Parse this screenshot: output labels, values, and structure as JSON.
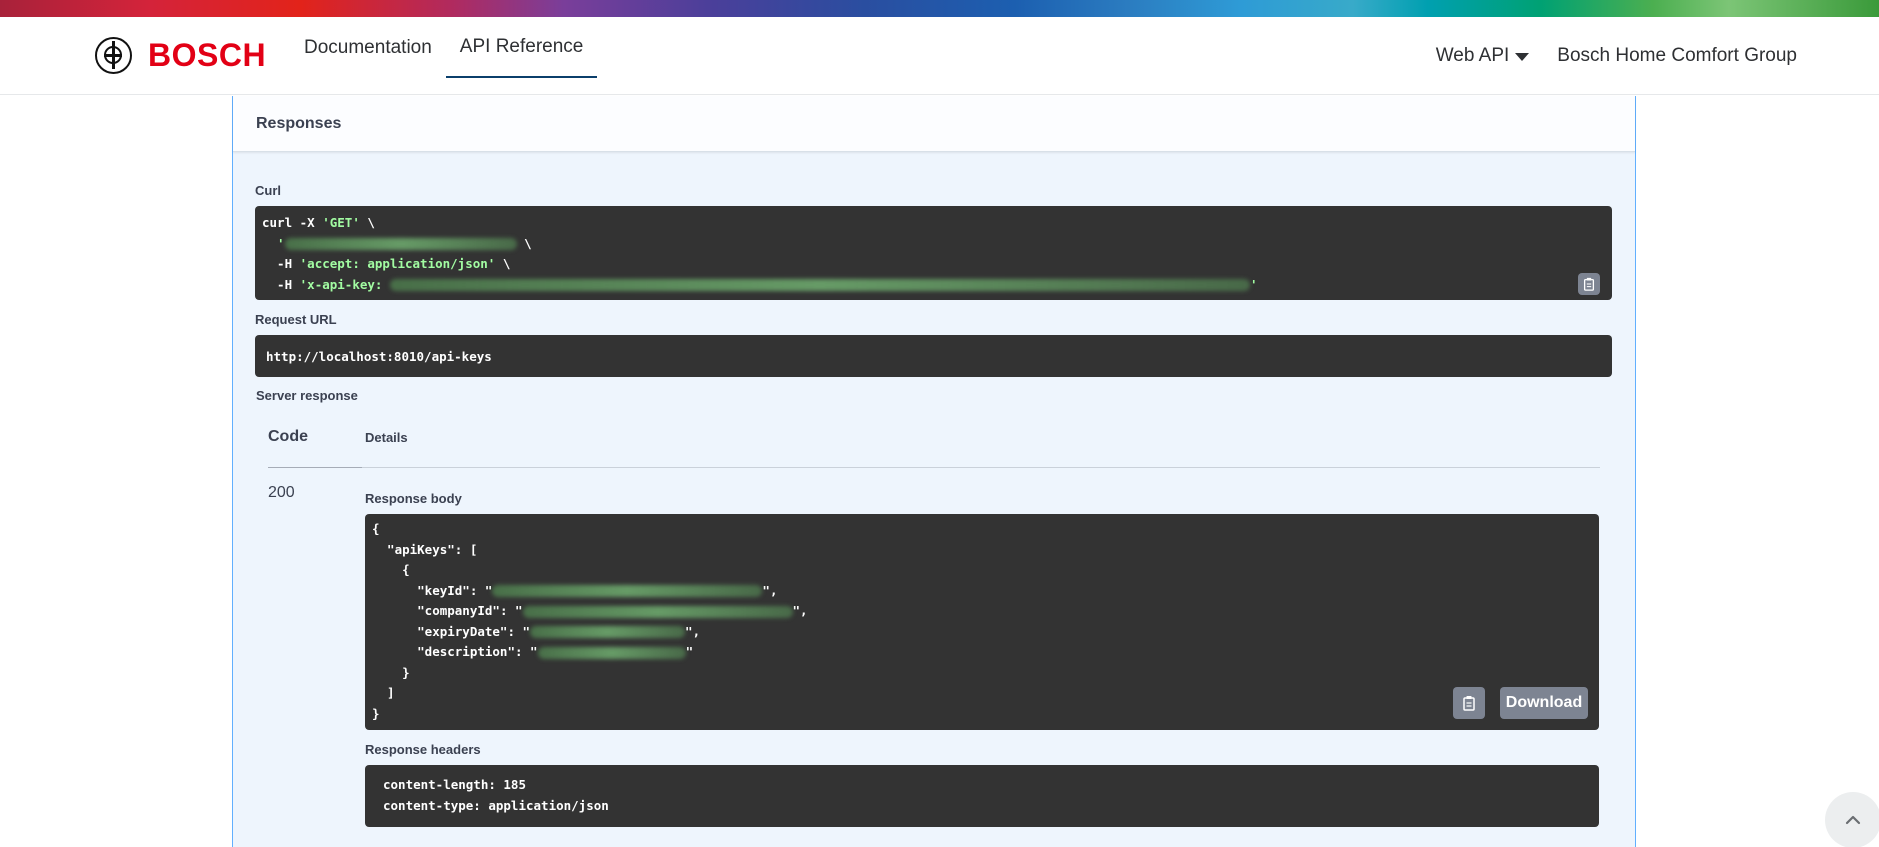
{
  "header": {
    "brand": "BOSCH",
    "nav": [
      "Documentation",
      "API Reference"
    ],
    "nav_active": "API Reference",
    "right": {
      "web_api": "Web API",
      "group": "Bosch Home Comfort Group"
    }
  },
  "responses": {
    "title": "Responses",
    "curl_label": "Curl",
    "curl": {
      "l1_cmd": "curl -X ",
      "l1_method": "'GET'",
      "l1_tail": " \\",
      "l2_open": "  '",
      "l2_tail": " \\",
      "l3_flag": "  -H ",
      "l3_val": "'accept: application/json'",
      "l3_tail": " \\",
      "l4_flag": "  -H ",
      "l4_val": "'x-api-key: ",
      "l4_close": "'"
    },
    "request_url_label": "Request URL",
    "request_url": "http://localhost:8010/api-keys",
    "server_response_label": "Server response",
    "table": {
      "code_header": "Code",
      "details_header": "Details"
    },
    "status_code": "200",
    "response_body_label": "Response body",
    "body": {
      "l1": "{",
      "l2_key": "  \"apiKeys\"",
      "l2_tail": ": [",
      "l3": "    {",
      "key_id": "      \"keyId\"",
      "company_id": "      \"companyId\"",
      "expiry_date": "      \"expiryDate\"",
      "description": "      \"description\"",
      "colon_quote": ": \"",
      "quote_comma": "\",",
      "quote": "\"",
      "l8": "    }",
      "l9": "  ]",
      "l10": "}"
    },
    "download_label": "Download",
    "response_headers_label": "Response headers",
    "headers_lines": [
      "content-length: 185",
      "content-type: application/json"
    ]
  },
  "icons": {
    "copy": "clipboard-icon",
    "scroll_top": "chevron-up-icon",
    "dropdown": "caret-down-icon",
    "logo": "bosch-armature-icon"
  },
  "colors": {
    "brand_red": "#e20015",
    "panel_bg": "#eef5fd",
    "panel_border": "#61affe",
    "code_bg": "#333333",
    "string_green": "#a2fca2",
    "button_gray": "#7d8492"
  }
}
